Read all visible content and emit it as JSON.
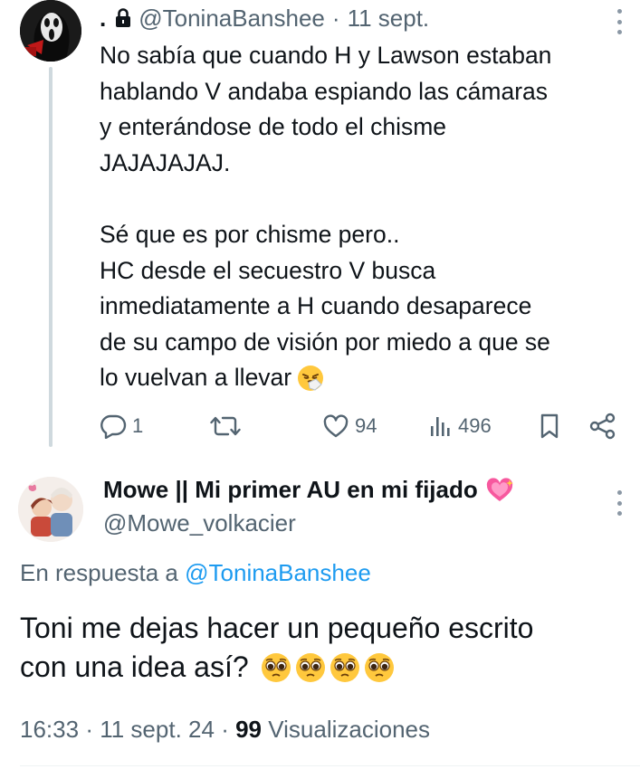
{
  "tweet": {
    "author_name": ".",
    "handle": "@ToninaBanshee",
    "separator": "·",
    "time": "11 sept.",
    "body_lines_1": [
      "No sabía que cuando H y Lawson estaban",
      "hablando V andaba espiando las cámaras",
      "y enterándose de todo el chisme",
      "JAJAJAJAJ."
    ],
    "body_lines_2": [
      "Sé que es por chisme pero..",
      "HC desde el secuestro V busca",
      "inmediatamente a H cuando desaparece",
      "de su campo de visión por miedo a que se",
      "lo vuelvan a llevar"
    ],
    "emoji": "sneezing-face",
    "stats": {
      "replies": "1",
      "retweets": "",
      "likes": "94",
      "views": "496"
    }
  },
  "reply": {
    "display_name": "Mowe || Mi primer AU en mi fijado",
    "name_emoji": "sparkling-heart",
    "handle": "@Mowe_volkacier",
    "in_reply_prefix": "En respuesta a",
    "in_reply_handle": "@ToninaBanshee",
    "body_line_1": "Toni me dejas hacer un pequeño escrito",
    "body_line_2": "con una idea así?",
    "body_emojis": [
      "pleading-face",
      "pleading-face",
      "pleading-face",
      "pleading-face"
    ],
    "time": "16:33",
    "sep1": "·",
    "date": "11 sept. 24",
    "sep2": "·",
    "views_count": "99",
    "views_label": "Visualizaciones"
  },
  "colors": {
    "text": "#0f1419",
    "secondary": "#536471",
    "link": "#1d9bf0",
    "divider": "#eff3f4",
    "thread_line": "#cfd9de"
  }
}
